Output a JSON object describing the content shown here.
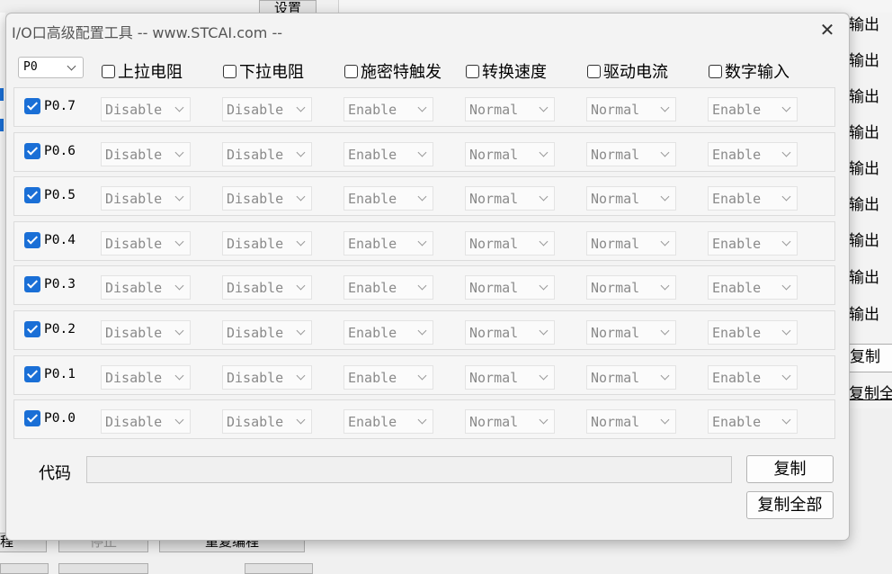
{
  "background": {
    "top_button": "设置",
    "output_labels": [
      "输出",
      "输出",
      "输出",
      "输出",
      "输出",
      "输出",
      "输出",
      "输出",
      "输出"
    ],
    "copy_label": "复制",
    "copy_all_label": "复制全",
    "bottom_left_label": "程",
    "bottom_stop_label": "停止",
    "bottom_repeat_label": "重复编程"
  },
  "dialog": {
    "title": "I/O口高级配置工具 -- www.STCAI.com --",
    "close_icon": "close-icon",
    "port": "P0",
    "headers": [
      "上拉电阻",
      "下拉电阻",
      "施密特触发",
      "转换速度",
      "驱动电流",
      "数字输入"
    ],
    "rows": [
      {
        "pin": "P0.7",
        "checked": true,
        "values": [
          "Disable",
          "Disable",
          "Enable",
          "Normal",
          "Normal",
          "Enable"
        ]
      },
      {
        "pin": "P0.6",
        "checked": true,
        "values": [
          "Disable",
          "Disable",
          "Enable",
          "Normal",
          "Normal",
          "Enable"
        ]
      },
      {
        "pin": "P0.5",
        "checked": true,
        "values": [
          "Disable",
          "Disable",
          "Enable",
          "Normal",
          "Normal",
          "Enable"
        ]
      },
      {
        "pin": "P0.4",
        "checked": true,
        "values": [
          "Disable",
          "Disable",
          "Enable",
          "Normal",
          "Normal",
          "Enable"
        ]
      },
      {
        "pin": "P0.3",
        "checked": true,
        "values": [
          "Disable",
          "Disable",
          "Enable",
          "Normal",
          "Normal",
          "Enable"
        ]
      },
      {
        "pin": "P0.2",
        "checked": true,
        "values": [
          "Disable",
          "Disable",
          "Enable",
          "Normal",
          "Normal",
          "Enable"
        ]
      },
      {
        "pin": "P0.1",
        "checked": true,
        "values": [
          "Disable",
          "Disable",
          "Enable",
          "Normal",
          "Normal",
          "Enable"
        ]
      },
      {
        "pin": "P0.0",
        "checked": true,
        "values": [
          "Disable",
          "Disable",
          "Enable",
          "Normal",
          "Normal",
          "Enable"
        ]
      }
    ],
    "code_label": "代码",
    "code_value": "",
    "copy_button": "复制",
    "copy_all_button": "复制全部"
  }
}
